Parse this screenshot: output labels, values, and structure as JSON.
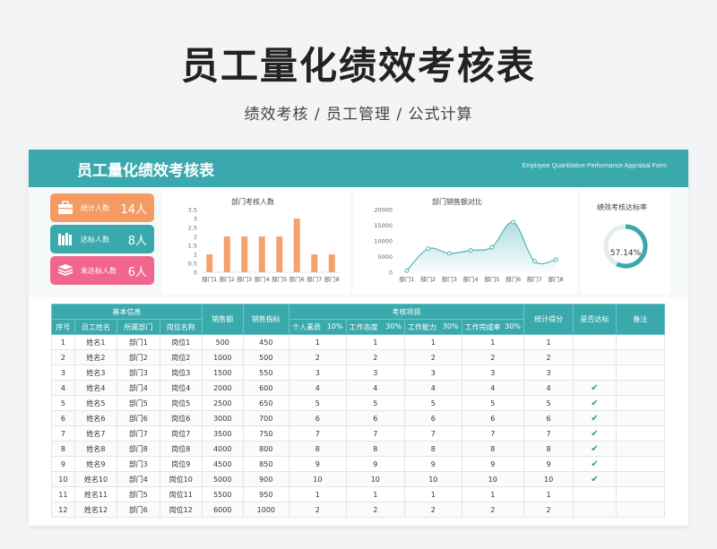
{
  "hero": {
    "title": "员工量化绩效考核表",
    "subtitle": "绩效考核 / 员工管理  / 公式计算"
  },
  "banner": {
    "title": "员工量化绩效考核表",
    "en": "Employee Quantitative Performance Appraisal Form"
  },
  "stats": [
    {
      "label": "统计人数",
      "value": "14人",
      "icon": "briefcase-icon",
      "color": "#f49a63"
    },
    {
      "label": "达标人数",
      "value": "8人",
      "icon": "books-icon",
      "color": "#3aa9ad"
    },
    {
      "label": "未达标人数",
      "value": "6人",
      "icon": "stack-icon",
      "color": "#f0668f"
    }
  ],
  "bar_chart_title": "部门考核人数",
  "line_chart_title": "部门销售额对比",
  "gauge": {
    "title": "绩效考核达标率",
    "label": "57.14%",
    "rate": 0.5714
  },
  "chart_data": [
    {
      "type": "bar",
      "title": "部门考核人数",
      "categories": [
        "部门1",
        "部门2",
        "部门3",
        "部门4",
        "部门5",
        "部门6",
        "部门7",
        "部门8"
      ],
      "values": [
        1,
        2,
        2,
        2,
        2,
        3,
        1,
        1
      ],
      "ylim": [
        0,
        3.5
      ],
      "yticks": [
        "0",
        "0.5",
        "1",
        "1.5",
        "2",
        "2.5",
        "3",
        "3.5"
      ],
      "color": "#f4a36c"
    },
    {
      "type": "area",
      "title": "部门销售额对比",
      "categories": [
        "部门1",
        "部门2",
        "部门3",
        "部门4",
        "部门5",
        "部门6",
        "部门7",
        "部门8"
      ],
      "values": [
        500,
        7500,
        6000,
        7000,
        8000,
        16000,
        3500,
        4000
      ],
      "ylim": [
        0,
        20000
      ],
      "yticks": [
        "0",
        "5000",
        "10000",
        "15000",
        "20000"
      ],
      "color": "#52b3b5"
    }
  ],
  "table": {
    "group_headers": {
      "basic": "基本信息",
      "sales": "销售额",
      "target": "销售指标",
      "items": "考核项目",
      "score": "统计得分",
      "reach": "是否达标",
      "note": "备注"
    },
    "sub_headers": {
      "no": "序号",
      "name": "员工姓名",
      "dept": "所属部门",
      "pos": "岗位名称"
    },
    "items": [
      {
        "name": "个人素质",
        "weight": "10%"
      },
      {
        "name": "工作态度",
        "weight": "30%"
      },
      {
        "name": "工作能力",
        "weight": "30%"
      },
      {
        "name": "工作完成率",
        "weight": "30%"
      }
    ],
    "rows": [
      {
        "no": "1",
        "name": "姓名1",
        "dept": "部门1",
        "pos": "岗位1",
        "sales": "500",
        "target": "450",
        "s1": "1",
        "s2": "1",
        "s3": "1",
        "s4": "1",
        "score": "1",
        "reach": false
      },
      {
        "no": "2",
        "name": "姓名2",
        "dept": "部门2",
        "pos": "岗位2",
        "sales": "1000",
        "target": "500",
        "s1": "2",
        "s2": "2",
        "s3": "2",
        "s4": "2",
        "score": "2",
        "reach": false
      },
      {
        "no": "3",
        "name": "姓名3",
        "dept": "部门3",
        "pos": "岗位3",
        "sales": "1500",
        "target": "550",
        "s1": "3",
        "s2": "3",
        "s3": "3",
        "s4": "3",
        "score": "3",
        "reach": false
      },
      {
        "no": "4",
        "name": "姓名4",
        "dept": "部门4",
        "pos": "岗位4",
        "sales": "2000",
        "target": "600",
        "s1": "4",
        "s2": "4",
        "s3": "4",
        "s4": "4",
        "score": "4",
        "reach": true
      },
      {
        "no": "5",
        "name": "姓名5",
        "dept": "部门5",
        "pos": "岗位5",
        "sales": "2500",
        "target": "650",
        "s1": "5",
        "s2": "5",
        "s3": "5",
        "s4": "5",
        "score": "5",
        "reach": true
      },
      {
        "no": "6",
        "name": "姓名6",
        "dept": "部门6",
        "pos": "岗位6",
        "sales": "3000",
        "target": "700",
        "s1": "6",
        "s2": "6",
        "s3": "6",
        "s4": "6",
        "score": "6",
        "reach": true
      },
      {
        "no": "7",
        "name": "姓名7",
        "dept": "部门7",
        "pos": "岗位7",
        "sales": "3500",
        "target": "750",
        "s1": "7",
        "s2": "7",
        "s3": "7",
        "s4": "7",
        "score": "7",
        "reach": true
      },
      {
        "no": "8",
        "name": "姓名8",
        "dept": "部门8",
        "pos": "岗位8",
        "sales": "4000",
        "target": "800",
        "s1": "8",
        "s2": "8",
        "s3": "8",
        "s4": "8",
        "score": "8",
        "reach": true
      },
      {
        "no": "9",
        "name": "姓名9",
        "dept": "部门3",
        "pos": "岗位9",
        "sales": "4500",
        "target": "850",
        "s1": "9",
        "s2": "9",
        "s3": "9",
        "s4": "9",
        "score": "9",
        "reach": true
      },
      {
        "no": "10",
        "name": "姓名10",
        "dept": "部门4",
        "pos": "岗位10",
        "sales": "5000",
        "target": "900",
        "s1": "10",
        "s2": "10",
        "s3": "10",
        "s4": "10",
        "score": "10",
        "reach": true
      },
      {
        "no": "11",
        "name": "姓名11",
        "dept": "部门5",
        "pos": "岗位11",
        "sales": "5500",
        "target": "950",
        "s1": "1",
        "s2": "1",
        "s3": "1",
        "s4": "1",
        "score": "1",
        "reach": false
      },
      {
        "no": "12",
        "name": "姓名12",
        "dept": "部门6",
        "pos": "岗位12",
        "sales": "6000",
        "target": "1000",
        "s1": "2",
        "s2": "2",
        "s3": "2",
        "s4": "2",
        "score": "2",
        "reach": false
      }
    ],
    "check_glyph": "✔"
  }
}
